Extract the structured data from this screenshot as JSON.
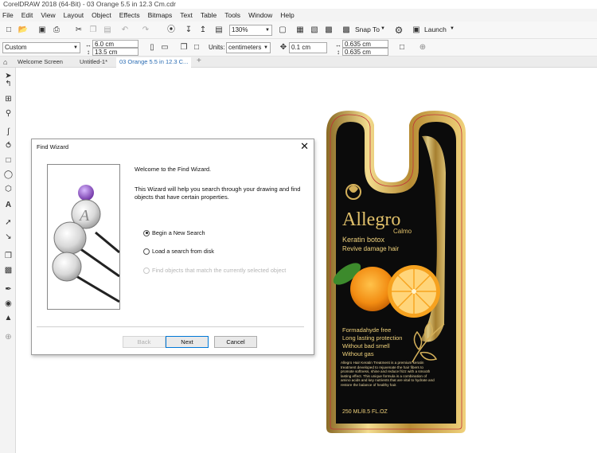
{
  "window": {
    "title": "CorelDRAW 2018 (64-Bit) - 03 Orange 5.5 in 12.3 Cm.cdr"
  },
  "menu": [
    "File",
    "Edit",
    "View",
    "Layout",
    "Object",
    "Effects",
    "Bitmaps",
    "Text",
    "Table",
    "Tools",
    "Window",
    "Help"
  ],
  "toolbar": {
    "zoom": "130%",
    "snap_label": "Snap To",
    "launch_label": "Launch"
  },
  "propertybar": {
    "preset": "Custom",
    "width": "6.0 cm",
    "height": "13.5 cm",
    "units_label": "Units:",
    "units_value": "centimeters",
    "nudge": "0.1 cm",
    "dup_x": "0.635 cm",
    "dup_y": "0.635 cm"
  },
  "tabs": [
    "Welcome Screen",
    "Untitled-1*",
    "03 Orange 5.5 in 12.3 C..."
  ],
  "dialog": {
    "title": "Find Wizard",
    "welcome": "Welcome to the Find Wizard.",
    "description": "This Wizard will help you search through your drawing and find objects that have certain properties.",
    "options": [
      {
        "label": "Begin a New Search",
        "selected": true,
        "enabled": true
      },
      {
        "label": "Load a search from disk",
        "selected": false,
        "enabled": true
      },
      {
        "label": "Find objects that match the currently selected object",
        "selected": false,
        "enabled": false
      }
    ],
    "buttons": {
      "back": "Back",
      "next": "Next",
      "cancel": "Cancel"
    }
  },
  "label_design": {
    "brand": "Allegro",
    "brand_sub": "Calmo",
    "product": "Keratin botox",
    "tagline": "Revive damage hair",
    "features": [
      "Formadahyde free",
      "Long lasting protection",
      "Without bad smell",
      "Without gas"
    ],
    "body": "Allegro Hair Keratin Treatment is a premium keratin treatment developed to rejuvenate the hair fibers to promote softness, shine and reduce frizz with a smooth lasting effect. This unique formula is a combination of amino acids and key nutrients that are vital to hydrate and restore the balance of healthy hair.",
    "volume": "250 ML/8.5 FL.OZ"
  },
  "colors": {
    "label_bg": "#0b0b0b",
    "gold": "#d4b05a",
    "orange": "#f28c12",
    "accent": "#2a6cb3"
  }
}
